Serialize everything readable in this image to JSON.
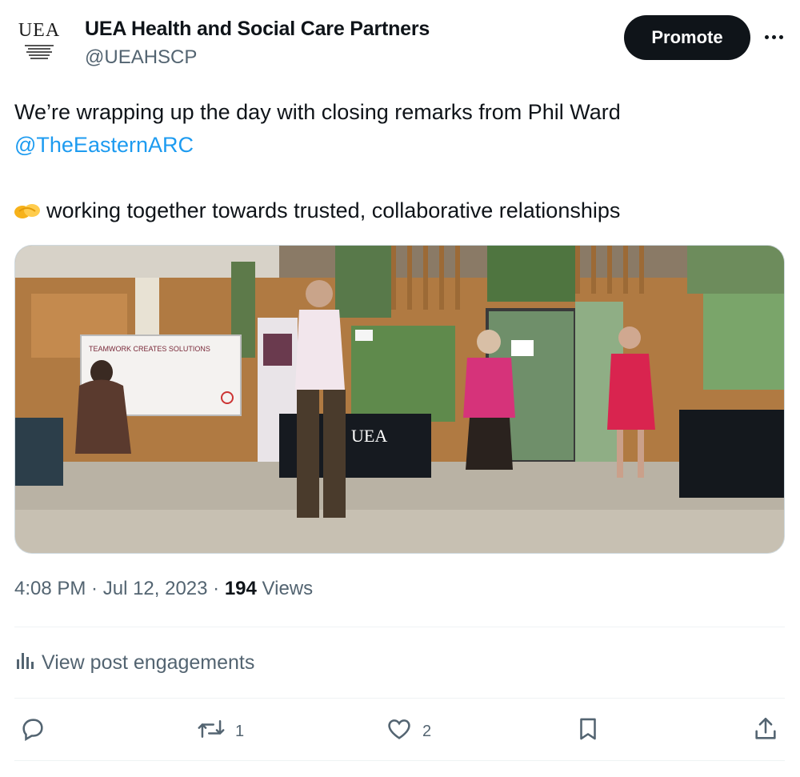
{
  "author": {
    "display_name": "UEA Health and Social Care Partners",
    "handle": "@UEAHSCP",
    "avatar_text": "UEA"
  },
  "header": {
    "promote_label": "Promote",
    "more_icon": "more-horizontal-icon"
  },
  "tweet": {
    "line1": "We’re wrapping up the day with closing remarks from Phil Ward",
    "mention": "@TheEasternARC",
    "emoji_icon": "handshake-emoji",
    "line3": "working together towards trusted, collaborative relationships"
  },
  "media": {
    "whiteboard_text": "TEAMWORK CREATES SOLUTIONS",
    "banner_text": "UEA"
  },
  "meta": {
    "time": "4:08 PM",
    "sep1": " · ",
    "date": "Jul 12, 2023",
    "sep2": " · ",
    "views_count": "194",
    "views_label": " Views"
  },
  "engagements": {
    "label": "View post engagements",
    "icon": "analytics-icon"
  },
  "actions": {
    "reply": {
      "icon": "reply-icon",
      "count": ""
    },
    "repost": {
      "icon": "repost-icon",
      "count": "1"
    },
    "like": {
      "icon": "heart-icon",
      "count": "2"
    },
    "bookmark": {
      "icon": "bookmark-icon",
      "count": ""
    },
    "share": {
      "icon": "share-icon",
      "count": ""
    }
  },
  "colors": {
    "text": "#0f1419",
    "secondary": "#536471",
    "link": "#1d9bf0",
    "promote_bg": "#0f1419",
    "divider": "#eff3f4"
  }
}
